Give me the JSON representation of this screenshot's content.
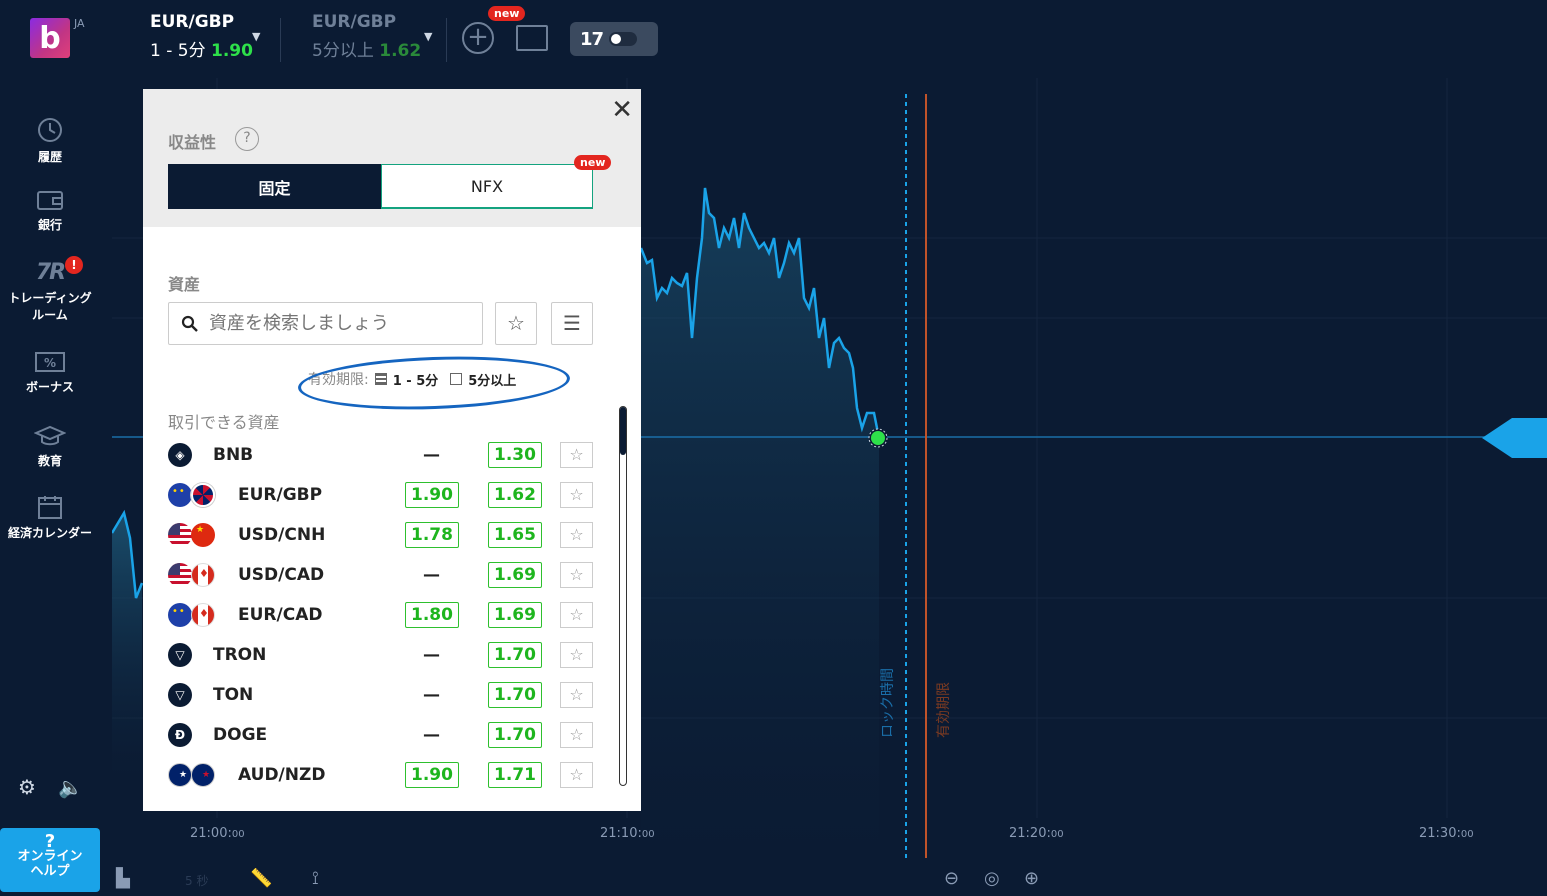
{
  "header": {
    "lang": "JA",
    "logo_letter": "b",
    "tab1": {
      "name": "EUR/GBP",
      "period": "1 - 5分",
      "value": "1.90"
    },
    "tab2": {
      "name": "EUR/GBP",
      "period": "5分以上",
      "value": "1.62"
    },
    "new_badge": "new"
  },
  "sidebar": {
    "items": [
      {
        "label": "履歴"
      },
      {
        "label": "銀行"
      },
      {
        "label_line1": "トレーディング",
        "label_line2": "ルーム",
        "alert": "!"
      },
      {
        "label": "ボーナス"
      },
      {
        "label": "教育"
      },
      {
        "label": "経済カレンダー"
      }
    ],
    "help": {
      "q": "?",
      "line1": "オンライン",
      "line2": "ヘルプ"
    }
  },
  "chart": {
    "x_ticks": [
      {
        "main": "21:00:",
        "sec": "00"
      },
      {
        "main": "21:10:",
        "sec": "00"
      },
      {
        "main": "21:20:",
        "sec": "00"
      },
      {
        "main": "21:30:",
        "sec": "00"
      }
    ],
    "lock_label": "ロック時間",
    "expiry_label": "有効期限",
    "timeframe": "5 秒",
    "colors": {
      "line": "#1aa3e8",
      "expiry": "#c0532a",
      "point": "#2ee04a"
    }
  },
  "panel": {
    "profit_label": "収益性",
    "help": "?",
    "seg_fixed": "固定",
    "seg_nfx": "NFX",
    "new_badge": "new",
    "asset_label": "資産",
    "search_placeholder": "資産を検索しましょう",
    "expiry_label": "有効期限:",
    "expiry_opt1": "1 - 5分",
    "expiry_opt2": "5分以上",
    "tradable_label": "取引できる資産",
    "assets": [
      {
        "name": "BNB",
        "v1": "—",
        "v2": "1.30"
      },
      {
        "name": "EUR/GBP",
        "v1": "1.90",
        "v2": "1.62"
      },
      {
        "name": "USD/CNH",
        "v1": "1.78",
        "v2": "1.65"
      },
      {
        "name": "USD/CAD",
        "v1": "—",
        "v2": "1.69"
      },
      {
        "name": "EUR/CAD",
        "v1": "1.80",
        "v2": "1.69"
      },
      {
        "name": "TRON",
        "v1": "—",
        "v2": "1.70"
      },
      {
        "name": "TON",
        "v1": "—",
        "v2": "1.70"
      },
      {
        "name": "DOGE",
        "v1": "—",
        "v2": "1.70"
      },
      {
        "name": "AUD/NZD",
        "v1": "1.90",
        "v2": "1.71"
      }
    ]
  }
}
